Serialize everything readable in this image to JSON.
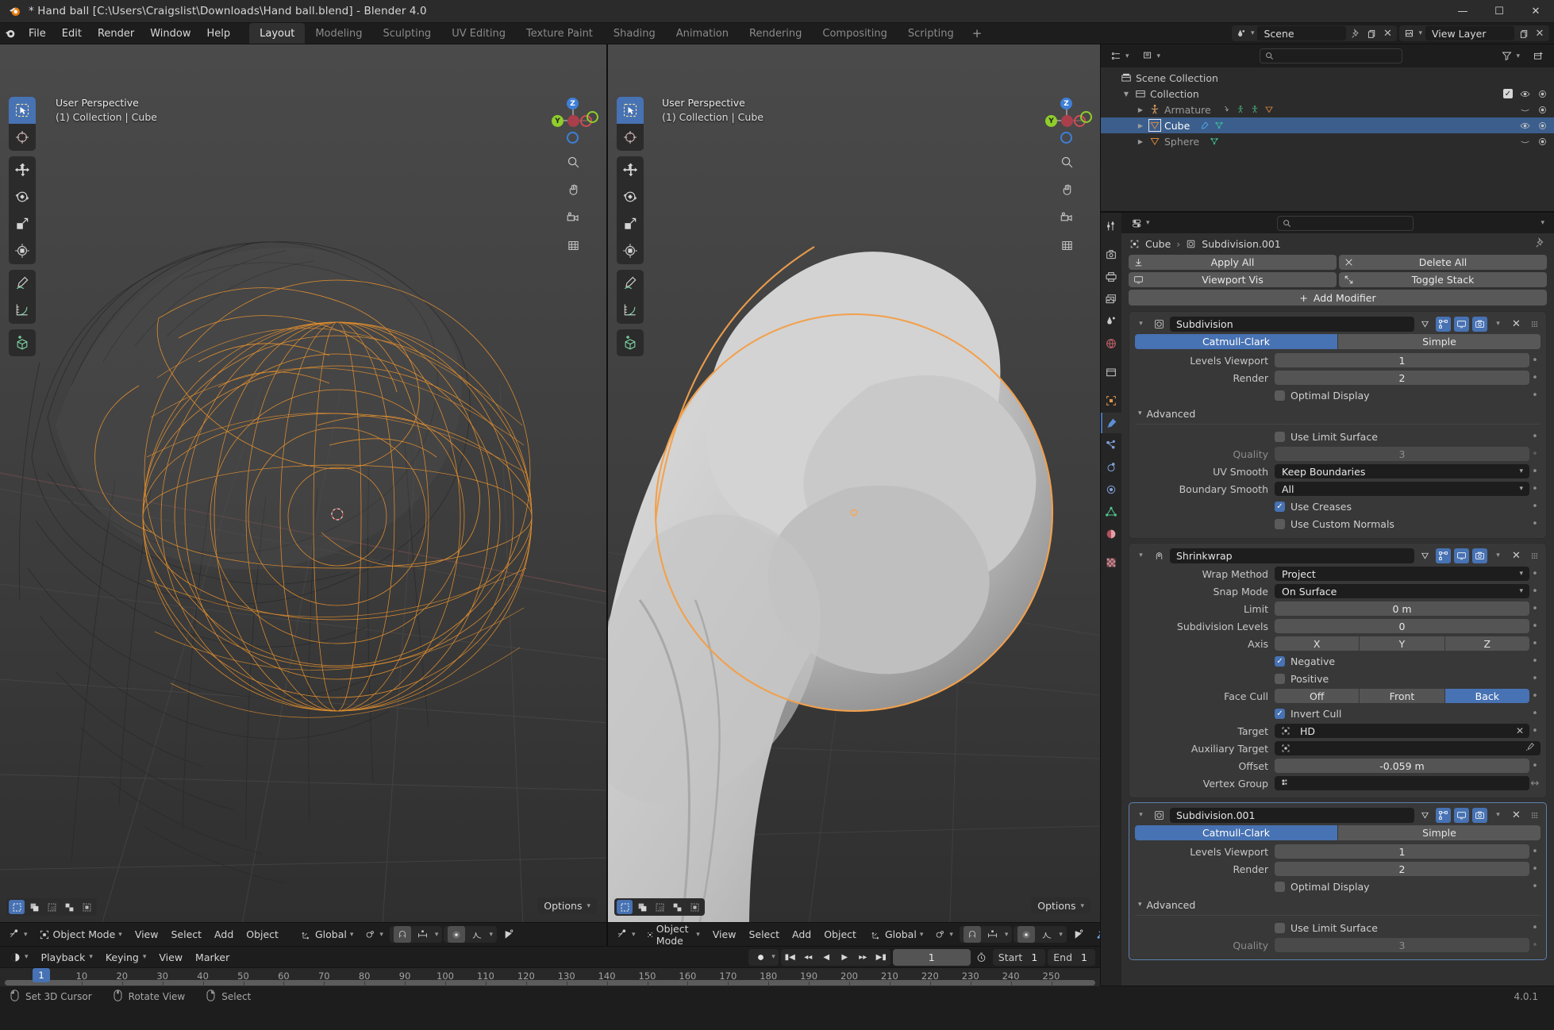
{
  "window": {
    "title": "* Hand ball [C:\\Users\\Craigslist\\Downloads\\Hand ball.blend] - Blender 4.0",
    "minimize": "—",
    "maximize": "☐",
    "close": "✕"
  },
  "topbar": {
    "menus": [
      "File",
      "Edit",
      "Render",
      "Window",
      "Help"
    ],
    "workspaces": [
      "Layout",
      "Modeling",
      "Sculpting",
      "UV Editing",
      "Texture Paint",
      "Shading",
      "Animation",
      "Rendering",
      "Compositing",
      "Scripting"
    ],
    "active_workspace": "Layout",
    "add_workspace": "+",
    "scene_name": "Scene",
    "view_layer_name": "View Layer"
  },
  "viewport_left": {
    "perspective": "User Perspective",
    "collection_line": "(1) Collection | Cube",
    "options_label": "Options",
    "gizmo_axes": {
      "z": "Z",
      "y": "Y",
      "x": "X"
    },
    "tools": [
      "tweak-select-tool",
      "cursor-tool",
      "move-tool",
      "rotate-tool",
      "scale-tool",
      "transform-tool",
      "annotate-tool",
      "measure-tool",
      "add-cube-tool"
    ],
    "header": {
      "mode": "Object Mode",
      "menus": [
        "View",
        "Select",
        "Add",
        "Object"
      ],
      "orientation": "Global"
    }
  },
  "viewport_right": {
    "perspective": "User Perspective",
    "collection_line": "(1) Collection | Cube",
    "options_label": "Options",
    "gizmo_axes": {
      "z": "Z",
      "y": "Y",
      "x": "X"
    },
    "header": {
      "mode": "Object Mode",
      "menus": [
        "View",
        "Select",
        "Add",
        "Object"
      ],
      "orientation": "Global"
    }
  },
  "timeline": {
    "menus": [
      "Playback",
      "Keying",
      "View",
      "Marker"
    ],
    "current_frame": "1",
    "start_label": "Start",
    "start_value": "1",
    "end_label": "End",
    "end_value": "1",
    "ticks": [
      "10",
      "20",
      "30",
      "40",
      "50",
      "60",
      "70",
      "80",
      "90",
      "100",
      "110",
      "120",
      "130",
      "140",
      "150",
      "160",
      "170",
      "180",
      "190",
      "200",
      "210",
      "220",
      "230",
      "240",
      "250"
    ],
    "playhead_frame": "1"
  },
  "outliner": {
    "rows": [
      {
        "label": "Scene Collection",
        "icon": "scene-collection-icon",
        "indent": 0,
        "arrow": "",
        "selected": false,
        "dim": false,
        "badges": []
      },
      {
        "label": "Collection",
        "icon": "collection-icon",
        "indent": 1,
        "arrow": "▼",
        "selected": false,
        "dim": false,
        "badges": [
          "checkbox-on",
          "eye",
          "camera"
        ]
      },
      {
        "label": "Armature",
        "icon": "armature-icon",
        "indent": 2,
        "arrow": "▶",
        "selected": false,
        "dim": true,
        "badges": [
          "eye-closed",
          "camera"
        ]
      },
      {
        "label": "Cube",
        "icon": "mesh-icon",
        "indent": 2,
        "arrow": "▶",
        "selected": true,
        "dim": false,
        "badges": [
          "eye",
          "camera"
        ]
      },
      {
        "label": "Sphere",
        "icon": "mesh-icon",
        "indent": 2,
        "arrow": "▶",
        "selected": false,
        "dim": true,
        "badges": [
          "eye-closed",
          "camera"
        ]
      }
    ]
  },
  "properties": {
    "breadcrumb": {
      "object": "Cube",
      "modifier": "Subdivision.001"
    },
    "buttons": {
      "apply_all": "Apply All",
      "delete_all": "Delete All",
      "viewport_vis": "Viewport Vis",
      "toggle_stack": "Toggle Stack",
      "add_modifier": "Add Modifier"
    },
    "modifiers": [
      {
        "name": "Subdivision",
        "type": "subdivision",
        "mode_options": [
          "Catmull-Clark",
          "Simple"
        ],
        "mode_active": "Catmull-Clark",
        "levels_viewport_label": "Levels Viewport",
        "levels_viewport": "1",
        "render_label": "Render",
        "render": "2",
        "optimal_display_label": "Optimal Display",
        "optimal_display": false,
        "advanced_label": "Advanced",
        "use_limit_surface_label": "Use Limit Surface",
        "use_limit_surface": false,
        "quality_label": "Quality",
        "quality": "3",
        "uv_smooth_label": "UV Smooth",
        "uv_smooth": "Keep Boundaries",
        "boundary_smooth_label": "Boundary Smooth",
        "boundary_smooth": "All",
        "use_creases_label": "Use Creases",
        "use_creases": true,
        "use_custom_normals_label": "Use Custom Normals",
        "use_custom_normals": false
      },
      {
        "name": "Shrinkwrap",
        "type": "shrinkwrap",
        "wrap_method_label": "Wrap Method",
        "wrap_method": "Project",
        "snap_mode_label": "Snap Mode",
        "snap_mode": "On Surface",
        "limit_label": "Limit",
        "limit": "0 m",
        "subdivision_levels_label": "Subdivision Levels",
        "subdivision_levels": "0",
        "axis_label": "Axis",
        "axis_options": [
          "X",
          "Y",
          "Z"
        ],
        "negative_label": "Negative",
        "negative": true,
        "positive_label": "Positive",
        "positive": false,
        "face_cull_label": "Face Cull",
        "face_cull_options": [
          "Off",
          "Front",
          "Back"
        ],
        "face_cull_active": "Back",
        "invert_cull_label": "Invert Cull",
        "invert_cull": true,
        "target_label": "Target",
        "target": "HD",
        "auxiliary_target_label": "Auxiliary Target",
        "auxiliary_target": "",
        "offset_label": "Offset",
        "offset": "-0.059 m",
        "vertex_group_label": "Vertex Group",
        "vertex_group": ""
      },
      {
        "name": "Subdivision.001",
        "type": "subdivision",
        "mode_options": [
          "Catmull-Clark",
          "Simple"
        ],
        "mode_active": "Catmull-Clark",
        "levels_viewport_label": "Levels Viewport",
        "levels_viewport": "1",
        "render_label": "Render",
        "render": "2",
        "optimal_display_label": "Optimal Display",
        "optimal_display": false,
        "advanced_label": "Advanced",
        "use_limit_surface_label": "Use Limit Surface",
        "use_limit_surface": false,
        "quality_label": "Quality",
        "quality": "3"
      }
    ]
  },
  "statusbar": {
    "items": [
      {
        "mouse": "left",
        "label": "Set 3D Cursor"
      },
      {
        "mouse": "middle",
        "label": "Rotate View"
      },
      {
        "mouse": "right",
        "label": "Select"
      }
    ],
    "version": "4.0.1"
  },
  "colors": {
    "accent_blue": "#4772b3",
    "selection_orange": "#ed9e5c",
    "panel_bg": "#303030",
    "header_bg": "#1d1d1d"
  }
}
